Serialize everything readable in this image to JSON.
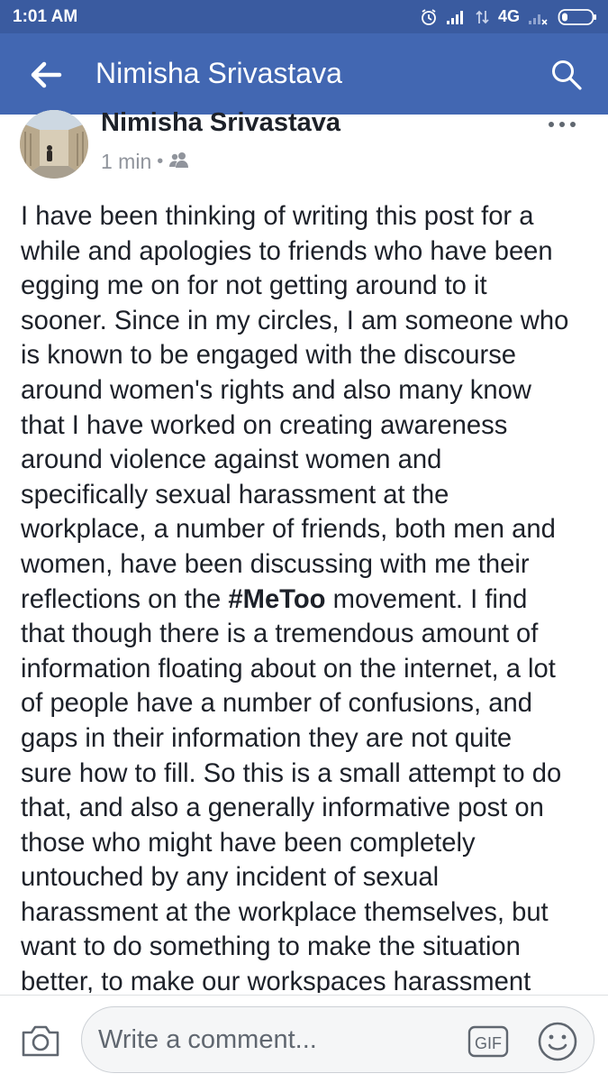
{
  "status_bar": {
    "time": "1:01 AM",
    "network": "4G",
    "icons": [
      "alarm-icon",
      "signal-icon",
      "data-arrows-icon",
      "signal-no-sim-icon",
      "battery-icon"
    ]
  },
  "app_bar": {
    "title": "Nimisha Srivastava",
    "icons": [
      "back-arrow-icon",
      "search-icon"
    ],
    "color": "#4267b2"
  },
  "post": {
    "author": "Nimisha Srivastava",
    "timestamp": "1 min",
    "separator": "•",
    "privacy_icon": "friends-icon",
    "menu_icon": "more-options-icon",
    "body_lines": [
      "I have been thinking of writing this post for a",
      "while and apologies to friends who have been",
      "egging me on for not getting around to it",
      "sooner. Since in my circles, I am someone who",
      "is known to be engaged with the discourse",
      "around women's rights and also many know",
      "that I have worked on creating awareness",
      "around violence against women and",
      "specifically sexual harassment at the",
      "workplace, a number of friends, both men and",
      "women, have been discussing with me their",
      {
        "before": "reflections on the ",
        "hashtag": "#MeToo",
        "after": " movement. I find"
      },
      "that though there is a tremendous amount of",
      "information floating about on the internet, a lot",
      "of people have a number of confusions, and",
      "gaps in their information they are not quite",
      "sure how to fill. So this is a small attempt to do",
      "that, and also a generally informative post on",
      "those who might have been completely",
      "untouched by any incident of sexual",
      "harassment at the workplace themselves, but",
      "want to do something to make the situation",
      "better, to make our workspaces harassment"
    ]
  },
  "comment_bar": {
    "placeholder": "Write a comment...",
    "gif_label": "GIF",
    "icons": [
      "camera-icon",
      "gif-icon",
      "emoji-icon"
    ]
  }
}
